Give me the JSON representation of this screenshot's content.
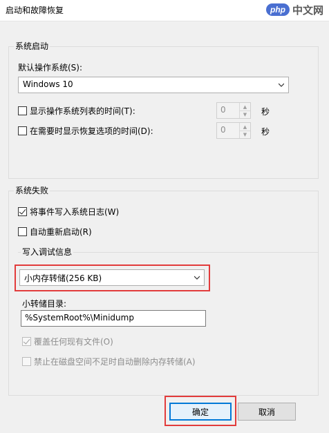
{
  "window": {
    "title": "启动和故障恢复",
    "watermark_badge": "php",
    "watermark_text": "中文网"
  },
  "system_startup": {
    "legend": "系统启动",
    "default_os_label": "默认操作系统(S):",
    "default_os_value": "Windows 10",
    "show_list_label": "显示操作系统列表的时间(T):",
    "show_list_checked": false,
    "show_list_value": "0",
    "show_recovery_label": "在需要时显示恢复选项的时间(D):",
    "show_recovery_checked": false,
    "show_recovery_value": "0",
    "seconds_unit": "秒"
  },
  "system_failure": {
    "legend": "系统失败",
    "write_event_label": "将事件写入系统日志(W)",
    "write_event_checked": true,
    "auto_restart_label": "自动重新启动(R)",
    "auto_restart_checked": false,
    "debug_info": {
      "legend": "写入调试信息",
      "dump_type_value": "小内存转储(256 KB)",
      "dump_dir_label": "小转储目录:",
      "dump_dir_value": "%SystemRoot%\\Minidump",
      "overwrite_label": "覆盖任何现有文件(O)",
      "overwrite_checked": true,
      "disable_auto_delete_label": "禁止在磁盘空间不足时自动删除内存转储(A)",
      "disable_auto_delete_checked": false
    }
  },
  "buttons": {
    "ok": "确定",
    "cancel": "取消"
  },
  "colors": {
    "highlight": "#e23b3b",
    "accent": "#0078d7"
  }
}
